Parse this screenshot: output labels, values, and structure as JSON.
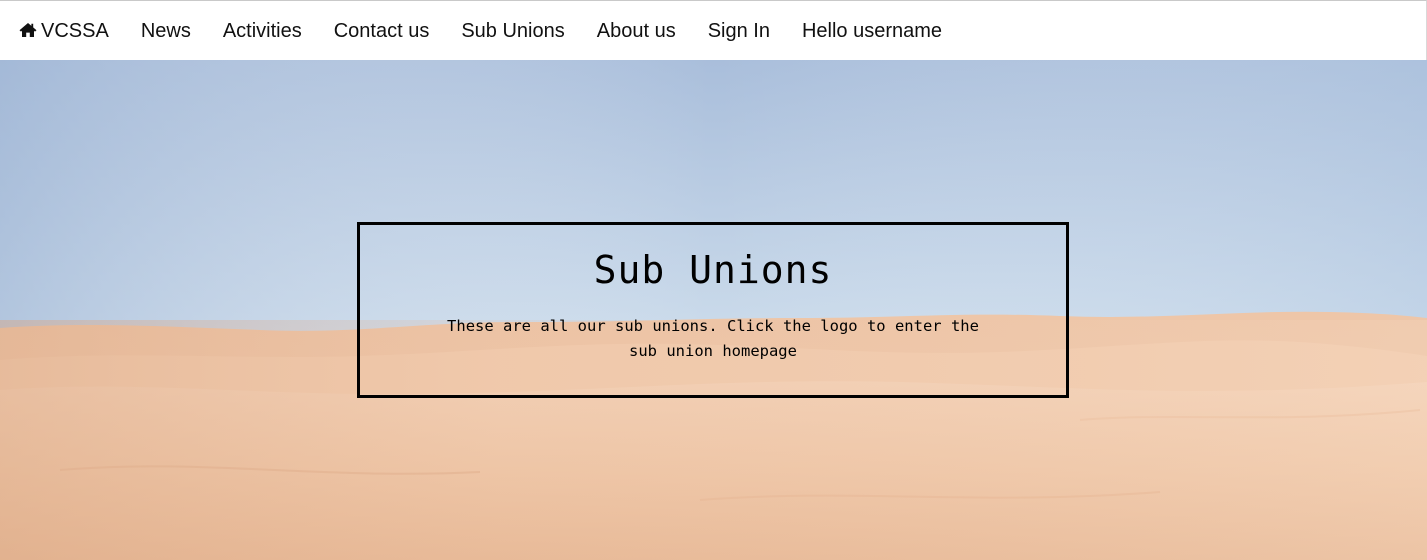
{
  "nav": {
    "brand": {
      "icon": "home-icon",
      "label": "VCSSA"
    },
    "items": [
      {
        "label": "News"
      },
      {
        "label": "Activities"
      },
      {
        "label": "Contact us"
      },
      {
        "label": "Sub Unions"
      },
      {
        "label": "About us"
      },
      {
        "label": "Sign In"
      },
      {
        "label": "Hello username"
      }
    ]
  },
  "hero": {
    "title": "Sub Unions",
    "description": "These are all our sub unions. Click the logo to enter the sub union homepage",
    "background": "desert-dunes-photo"
  },
  "colors": {
    "sky_top": "#a9bfdc",
    "sky_bottom": "#e4ecf4",
    "sand_light": "#f5d6bd",
    "sand_dark": "#e6b796",
    "frame": "#000000"
  }
}
